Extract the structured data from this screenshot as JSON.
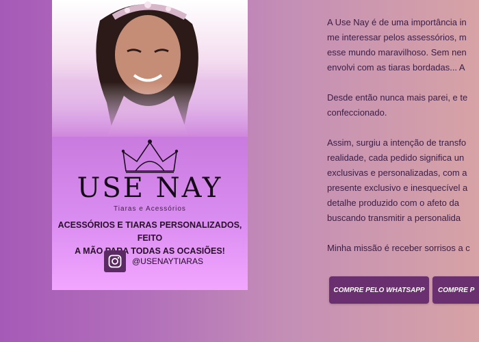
{
  "promo_card": {
    "brand": "USE NAY",
    "brand_subtitle": "Tiaras e Acessórios",
    "tagline_line1": "ACESSÓRIOS E TIARAS PERSONALIZADOS, FEITO",
    "tagline_line2": "A MÃO PARA TODAS AS OCASIÕES!",
    "instagram_handle": "@USENAYTIARAS",
    "icons": [
      "crown-logo-icon",
      "instagram-icon"
    ]
  },
  "about": {
    "paragraph1": [
      "A Use Nay é de uma importância in",
      "me interessar pelos assessórios, m",
      "esse mundo maravilhoso. Sem nen",
      "envolvi com as tiaras bordadas... A"
    ],
    "paragraph2": [
      "Desde então nunca mais parei, e te",
      "confeccionado."
    ],
    "paragraph3": [
      "Assim, surgiu a intenção de transfo",
      "realidade, cada pedido significa un",
      "exclusivas e personalizadas, com a",
      "presente exclusivo e inesquecível a",
      "detalhe produzido com o afeto da",
      "buscando transmitir a personalida"
    ],
    "paragraph4": [
      "Minha missão é receber sorrisos a c"
    ]
  },
  "actions": {
    "whatsapp_label": "COMPRE PELO WHATSAPP",
    "second_label": "COMPRE P"
  },
  "colors": {
    "button_bg": "#6a2f6e",
    "text": "#3a1c45",
    "card_gradient_end": "#f2a6ff"
  }
}
